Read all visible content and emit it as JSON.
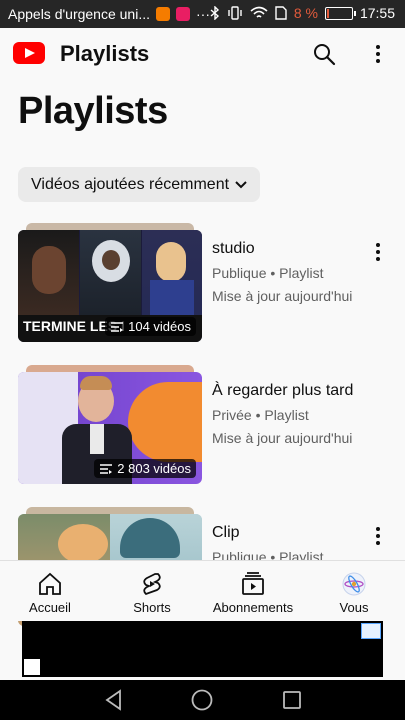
{
  "status_bar": {
    "notification_text": "Appels d'urgence uni...",
    "overflow": "···",
    "battery": "8 %",
    "battery_level": 0.08,
    "time": "17:55"
  },
  "app_bar": {
    "title": "Playlists"
  },
  "page": {
    "title": "Playlists",
    "sort_label": "Vidéos ajoutées récemment"
  },
  "playlists": [
    {
      "title": "studio",
      "meta": "Publique • Playlist",
      "updated": "Mise à jour aujourd'hui",
      "count": "104 vidéos",
      "thumb_text": "TERMINE LES I"
    },
    {
      "title": "À regarder plus tard",
      "meta": "Privée • Playlist",
      "updated": "Mise à jour aujourd'hui",
      "count": "2 803 vidéos"
    },
    {
      "title": "Clip",
      "meta": "Publique • Playlist"
    }
  ],
  "bottom_nav": [
    "Accueil",
    "Shorts",
    "Abonnements",
    "Vous"
  ],
  "colors": {
    "brand_red": "#ff0000",
    "battery_low": "#e35b3c"
  },
  "icons": [
    "youtube-logo-icon",
    "search-icon",
    "more-vert-icon",
    "chevron-down-icon",
    "playlist-icon",
    "home-icon",
    "shorts-icon",
    "subscriptions-icon",
    "avatar-icon",
    "back-icon",
    "home-circle-icon",
    "recents-icon"
  ]
}
